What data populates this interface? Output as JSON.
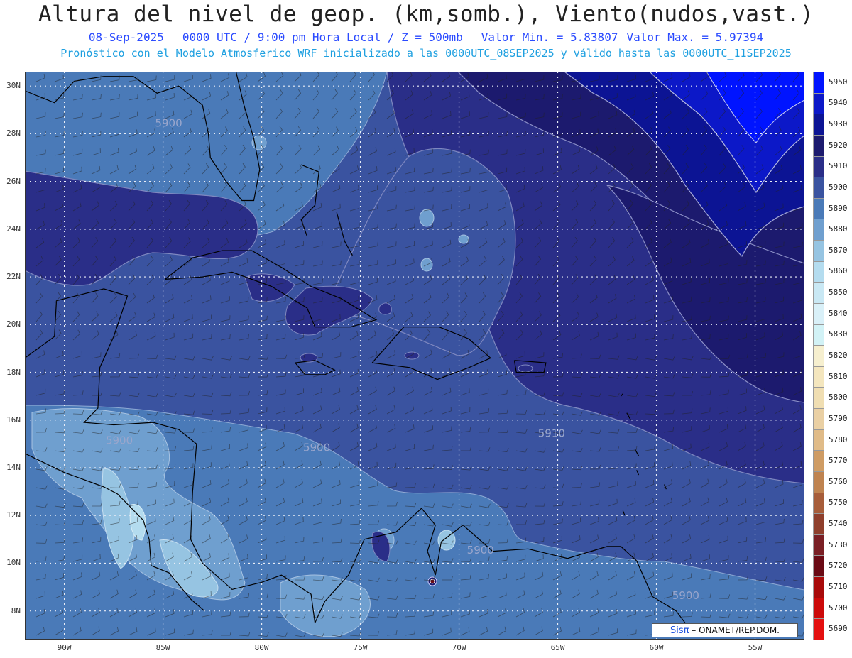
{
  "header": {
    "title": "Altura del nivel de geop. (km,somb.), Viento(nudos,vast.)",
    "date": "08-Sep-2025",
    "time": "0000 UTC / 9:00 pm Hora Local / Z = 500mb",
    "min_value": "Valor Min. = 5.83807",
    "max_value": "Valor Max. = 5.97394",
    "forecast_note": "Pronóstico con el Modelo Atmosferico WRF inicializado a las 0000UTC_08SEP2025 y válido hasta las  0000UTC_11SEP2025"
  },
  "map": {
    "lon_range": [
      -92.0,
      -52.5
    ],
    "lat_range": [
      6.8,
      30.6
    ],
    "lat_ticks": [
      "30N",
      "28N",
      "26N",
      "24N",
      "22N",
      "20N",
      "18N",
      "16N",
      "14N",
      "12N",
      "10N",
      "8N"
    ],
    "lat_values": [
      30,
      28,
      26,
      24,
      22,
      20,
      18,
      16,
      14,
      12,
      10,
      8
    ],
    "lon_ticks": [
      "90W",
      "85W",
      "80W",
      "75W",
      "70W",
      "65W",
      "60W",
      "55W"
    ],
    "lon_values": [
      -90,
      -85,
      -80,
      -75,
      -70,
      -65,
      -60,
      -55
    ],
    "contour_labels": [
      {
        "text": "5900",
        "lon": -85.4,
        "lat": 28.3
      },
      {
        "text": "5900",
        "lon": -87.9,
        "lat": 15.0
      },
      {
        "text": "5900",
        "lon": -77.9,
        "lat": 14.7
      },
      {
        "text": "5910",
        "lon": -66.0,
        "lat": 15.3
      },
      {
        "text": "5900",
        "lon": -69.6,
        "lat": 10.4
      },
      {
        "text": "5900",
        "lon": -59.2,
        "lat": 8.5
      }
    ]
  },
  "legend": {
    "levels": [
      "5950",
      "5940",
      "5930",
      "5920",
      "5910",
      "5900",
      "5890",
      "5880",
      "5870",
      "5860",
      "5850",
      "5840",
      "5830",
      "5820",
      "5810",
      "5800",
      "5790",
      "5780",
      "5770",
      "5760",
      "5750",
      "5740",
      "5730",
      "5720",
      "5710",
      "5700",
      "5690"
    ],
    "colors": [
      "#0014ff",
      "#0c18c8",
      "#0c1494",
      "#1c1a6e",
      "#2a2e88",
      "#3a53a0",
      "#4a7ab8",
      "#6f9fcf",
      "#96c4e2",
      "#b4dcef",
      "#c9e8f4",
      "#d9f0f8",
      "#d2f2f6",
      "#f6efcf",
      "#f4e6be",
      "#f0deb2",
      "#ead0a4",
      "#e0bb88",
      "#cf9c64",
      "#bf8350",
      "#a75d3a",
      "#8f3f2c",
      "#7a1f24",
      "#6a0a14",
      "#a80a0a",
      "#cc0a0a",
      "#e41010"
    ]
  },
  "credit": {
    "brand": "Sisπ",
    "text": " – ONAMET/REP.DOM."
  }
}
